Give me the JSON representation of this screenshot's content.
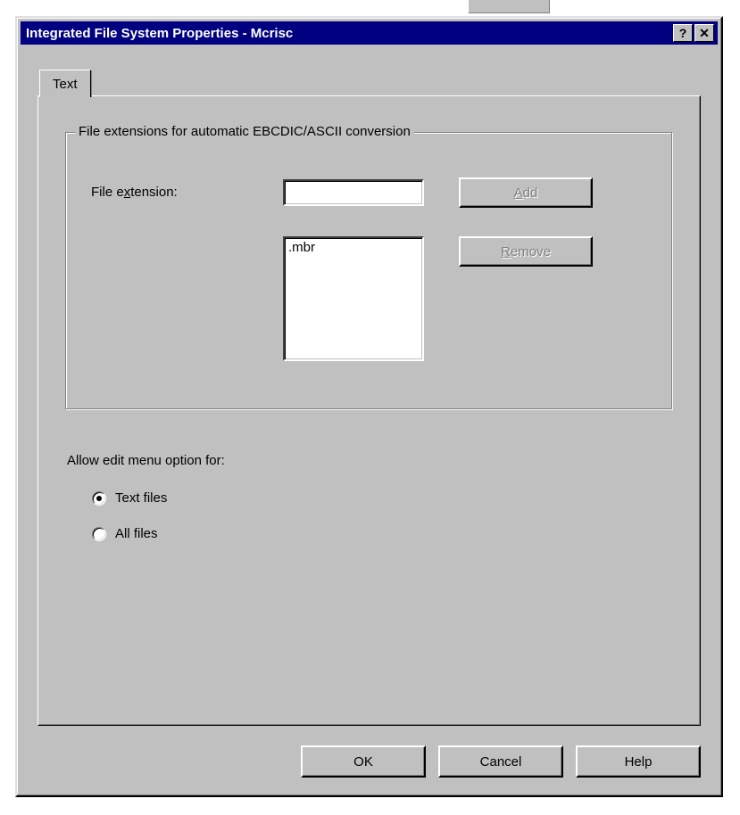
{
  "window": {
    "title": "Integrated File System Properties - Mcrisc",
    "help_btn": "?",
    "close_btn": "✕"
  },
  "tab": {
    "label": "Text"
  },
  "groupbox": {
    "legend": "File extensions for automatic EBCDIC/ASCII conversion",
    "field_label_pre": "File e",
    "field_label_u": "x",
    "field_label_post": "tension:",
    "input_value": "",
    "list_items": [
      ".mbr"
    ],
    "add_label_u": "A",
    "add_label_post": "dd",
    "remove_label_u": "R",
    "remove_label_post": "emove"
  },
  "allow": {
    "label": "Allow edit menu option for:",
    "options": [
      {
        "label": "Text files",
        "selected": true
      },
      {
        "label": "All files",
        "selected": false
      }
    ]
  },
  "buttons": {
    "ok": "OK",
    "cancel": "Cancel",
    "help": "Help"
  }
}
